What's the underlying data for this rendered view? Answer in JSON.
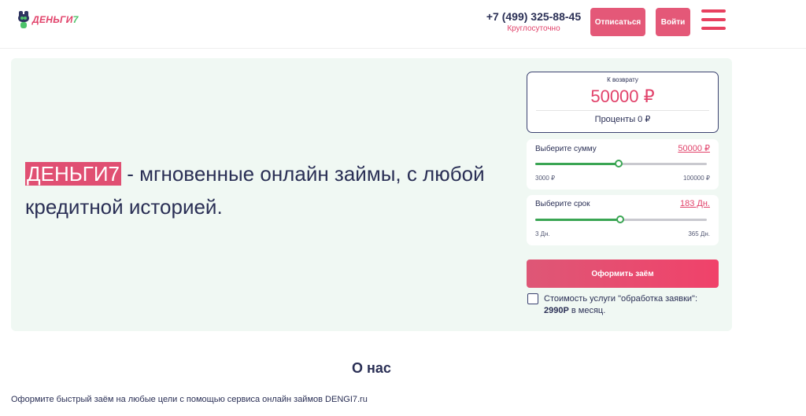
{
  "header": {
    "logo_text_a": "ДЕНЬГИ",
    "logo_text_b": "7",
    "phone": "+7 (499) 325-88-45",
    "phone_hours": "Круглосуточно",
    "unsubscribe_label": "Отписаться",
    "login_label": "Войти",
    "menu_icon": "hamburger-menu-icon"
  },
  "hero": {
    "brand": "ДЕНЬГИ7",
    "title_rest": " - мгновенные онлайн займы, с любой кредитной историей."
  },
  "calculator": {
    "return_label": "К возврату",
    "return_amount": "50000 ₽",
    "interest": "Проценты 0 ₽",
    "amount": {
      "label": "Выберите сумму",
      "value": "50000 ₽",
      "min": "3000 ₽",
      "max": "100000 ₽",
      "fraction": 0.485
    },
    "term": {
      "label": "Выберите срок",
      "value": "183 Дн.",
      "min": "3 Дн.",
      "max": "365 Дн.",
      "fraction": 0.497
    },
    "apply_label": "Оформить заём",
    "consent_text": "Стоимость услуги \"обработка заявки\": ",
    "consent_price": "2990Р",
    "consent_suffix": " в месяц."
  },
  "about": {
    "title": "О нас",
    "text": "Оформите быстрый заём на любые цели с помощью сервиса онлайн займов DENGI7.ru"
  },
  "colors": {
    "accent": "#e1426a",
    "dark": "#2a2f55",
    "green": "#3aa553",
    "hero_bg": "#f0f8f3"
  }
}
